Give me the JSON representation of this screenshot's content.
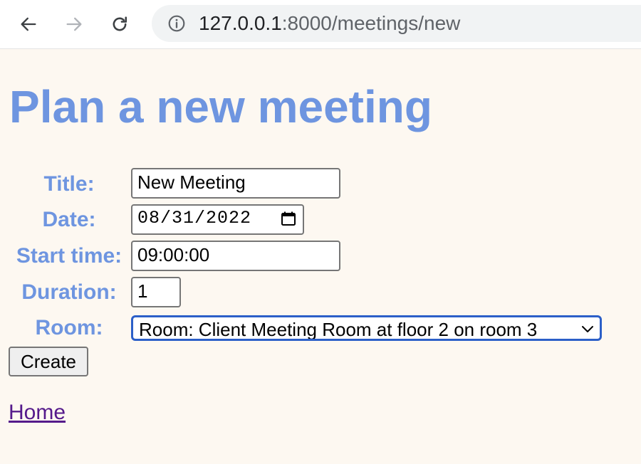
{
  "browser": {
    "back_icon": "arrow-left-icon",
    "forward_icon": "arrow-right-icon",
    "reload_icon": "reload-icon",
    "info_icon": "info-circle-icon",
    "url_host": "127.0.0.1",
    "url_rest": ":8000/meetings/new"
  },
  "page": {
    "title": "Plan a new meeting",
    "heading_color": "#6e95e0",
    "background": "#fdf8f1"
  },
  "form": {
    "title_label": "Title:",
    "title_value": "New Meeting",
    "date_label": "Date:",
    "date_value": "08/31/2022",
    "start_label": "Start time:",
    "start_value": "09:00:00",
    "duration_label": "Duration:",
    "duration_value": "1",
    "room_label": "Room:",
    "room_value": "Room: Client Meeting Room at floor 2 on room 3",
    "create_label": "Create"
  },
  "links": {
    "home": "Home"
  }
}
